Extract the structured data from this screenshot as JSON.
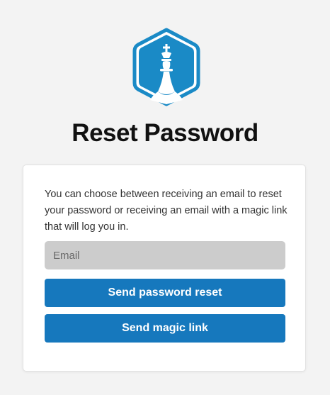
{
  "colors": {
    "background": "#f3f3f3",
    "card": "#ffffff",
    "primary": "#1678bd",
    "input": "#cccccc",
    "logo": "#1a8ac6"
  },
  "logo": {
    "icon": "chess-king-icon"
  },
  "header": {
    "title": "Reset Password"
  },
  "card": {
    "description": "You can choose between receiving an email to reset your password or receiving an email with a magic link that will log you in.",
    "email": {
      "placeholder": "Email",
      "value": ""
    },
    "reset_button": "Send password reset",
    "magic_button": "Send magic link"
  }
}
